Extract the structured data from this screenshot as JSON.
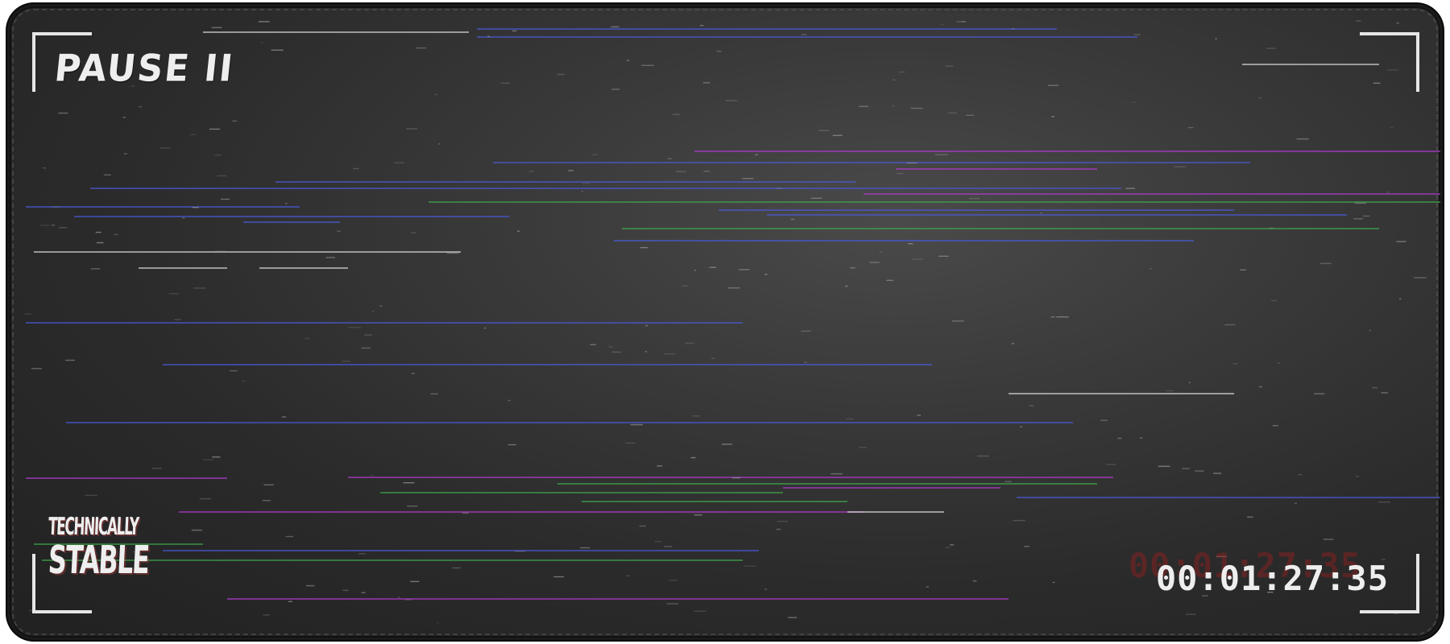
{
  "osd": {
    "status_label": "PAUSE II",
    "timecode": "00:01:27:35"
  },
  "brand": {
    "line1": "TECHNICALLY",
    "line2": "STABLE"
  },
  "colors": {
    "mat_background": "#333333",
    "frame_brackets": "#e6e6e6",
    "glitch_blue": "#4a5ad8",
    "glitch_purple": "#b03ad0",
    "glitch_green": "#3ea84a",
    "glitch_white": "#d8d8d8",
    "ghost_timecode": "#961e1e"
  },
  "icons": {
    "viewfinder_corners": "corner-bracket-icon"
  }
}
